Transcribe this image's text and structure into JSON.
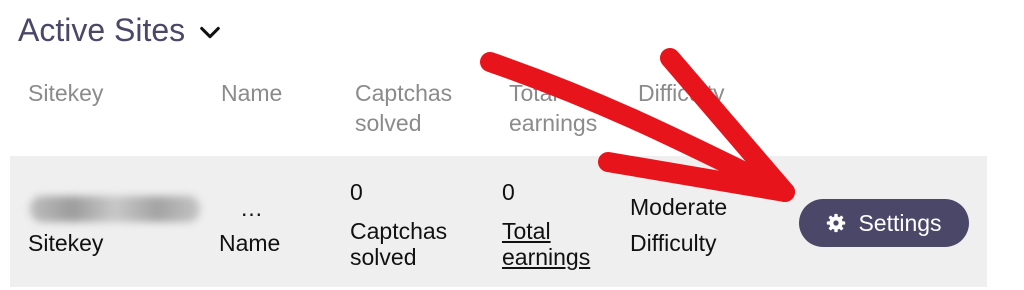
{
  "section": {
    "title": "Active Sites",
    "toggle_icon": "chevron-down-icon"
  },
  "table": {
    "headers": {
      "sitekey": "Sitekey",
      "name": "Name",
      "captchas_line1": "Captchas",
      "captchas_line2": "solved",
      "earnings_line1": "Total",
      "earnings_line2": "earnings",
      "difficulty": "Difficulty"
    },
    "row": {
      "sitekey_label": "Sitekey",
      "name_value": "…",
      "name_label": "Name",
      "captchas_value": "0",
      "captchas_label_line1": "Captchas",
      "captchas_label_line2": "solved",
      "earnings_value": "0",
      "earnings_label_line1": "Total",
      "earnings_label_line2": "earnings",
      "difficulty_value": "Moderate",
      "difficulty_label": "Difficulty",
      "settings_label": "Settings",
      "settings_icon": "gear-icon"
    }
  },
  "annotation": {
    "arrow_color": "#e8141b"
  }
}
